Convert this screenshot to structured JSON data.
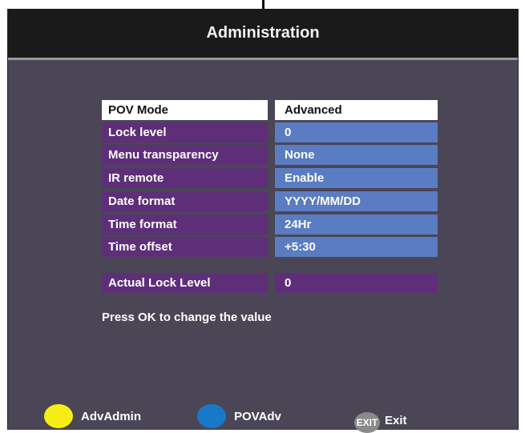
{
  "header": {
    "title": "Administration"
  },
  "settings": [
    {
      "label": "POV Mode",
      "value": "Advanced"
    },
    {
      "label": "Lock level",
      "value": "0"
    },
    {
      "label": "Menu transparency",
      "value": "None"
    },
    {
      "label": "IR remote",
      "value": "Enable"
    },
    {
      "label": "Date format",
      "value": "YYYY/MM/DD"
    },
    {
      "label": "Time format",
      "value": "24Hr"
    },
    {
      "label": "Time offset",
      "value": "+5:30"
    }
  ],
  "actual": {
    "label": "Actual Lock Level",
    "value": "0"
  },
  "hint": "Press OK to change the value",
  "footer": {
    "yellow_label": "AdvAdmin",
    "blue_label": "POVAdv",
    "exit_icon_text": "EXIT",
    "exit_label": "Exit"
  },
  "colors": {
    "background": "#4a4656",
    "label_bg": "#5e2f78",
    "value_bg": "#5a7cc2",
    "yellow_button": "#f6ee13",
    "blue_button": "#1879c9"
  }
}
